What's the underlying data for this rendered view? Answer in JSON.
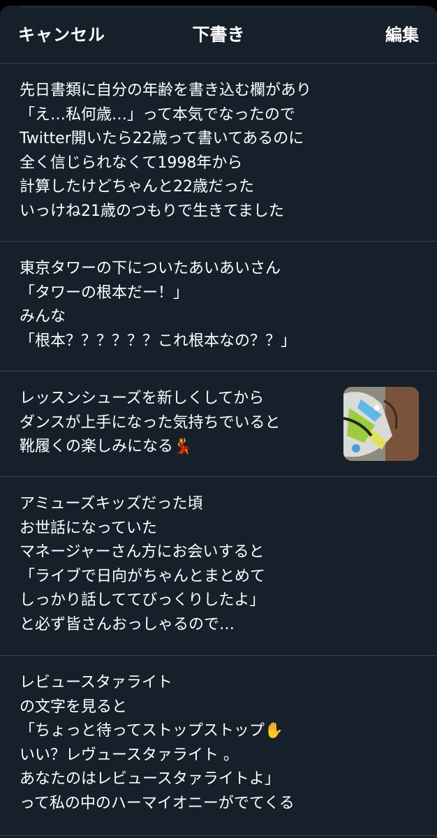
{
  "header": {
    "cancel_label": "キャンセル",
    "title": "下書き",
    "edit_label": "編集"
  },
  "drafts": [
    {
      "text": "先日書類に自分の年齢を書き込む欄があり\n「え…私何歳…」って本気でなったので\nTwitter開いたら22歳って書いてあるのに\n全く信じられなくて1998年から\n計算したけどちゃんと22歳だった\nいっけね21歳のつもりで生きてました"
    },
    {
      "text": "東京タワーの下についたあいあいさん\n「タワーの根本だー！」\nみんな\n「根本？？？？？？これ根本なの？？」"
    },
    {
      "text": "レッスンシューズを新しくしてから\nダンスが上手になった気持ちでいると\n靴履くの楽しみになる💃",
      "has_image": true,
      "image_icon": "shoes-photo"
    },
    {
      "text": "アミューズキッズだった頃\nお世話になっていた\nマネージャーさん方にお会いすると\n「ライブで日向がちゃんとまとめて\nしっかり話しててびっくりしたよ」\nと必ず皆さんおっしゃるので…"
    },
    {
      "text": "レビュースタァライト\nの文字を見ると\n「ちょっと待ってストップストップ✋\nいい？レヴュースタァライト 。\nあなたのはレビュースタァライトよ」\nって私の中のハーマイオニーがでてくる"
    }
  ],
  "colors": {
    "background": "#15202b",
    "divider": "#38444d",
    "text": "#ffffff"
  }
}
